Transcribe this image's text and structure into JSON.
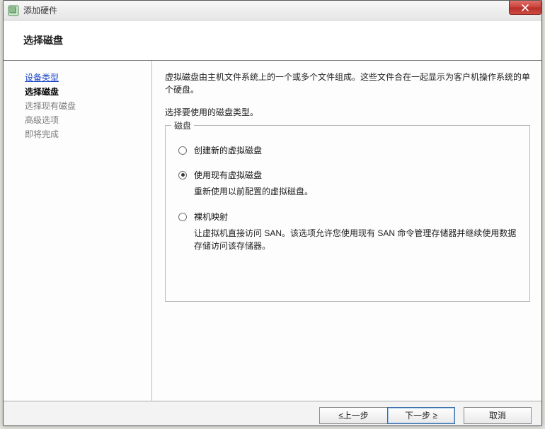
{
  "window": {
    "title": "添加硬件"
  },
  "heading": "选择磁盘",
  "sidebar": {
    "steps": [
      {
        "label": "设备类型",
        "state": "link"
      },
      {
        "label": "选择磁盘",
        "state": "current"
      },
      {
        "label": "选择现有磁盘",
        "state": "future"
      },
      {
        "label": "高级选项",
        "state": "future"
      },
      {
        "label": "即将完成",
        "state": "future"
      }
    ]
  },
  "content": {
    "description": "虚拟磁盘由主机文件系统上的一个或多个文件组成。这些文件合在一起显示为客户机操作系统的单个硬盘。",
    "prompt": "选择要使用的磁盘类型。",
    "group_label": "磁盘",
    "options": [
      {
        "id": "create-new",
        "label": "创建新的虚拟磁盘",
        "desc": "",
        "checked": false
      },
      {
        "id": "use-existing",
        "label": "使用现有虚拟磁盘",
        "desc": "重新使用以前配置的虚拟磁盘。",
        "checked": true
      },
      {
        "id": "raw-mapping",
        "label": "裸机映射",
        "desc": "让虚拟机直接访问 SAN。该选项允许您使用现有 SAN 命令管理存储器并继续使用数据存储访问该存储器。",
        "checked": false
      }
    ]
  },
  "footer": {
    "back": "≤上一步",
    "next": "下一步 ≥",
    "cancel": "取消"
  }
}
